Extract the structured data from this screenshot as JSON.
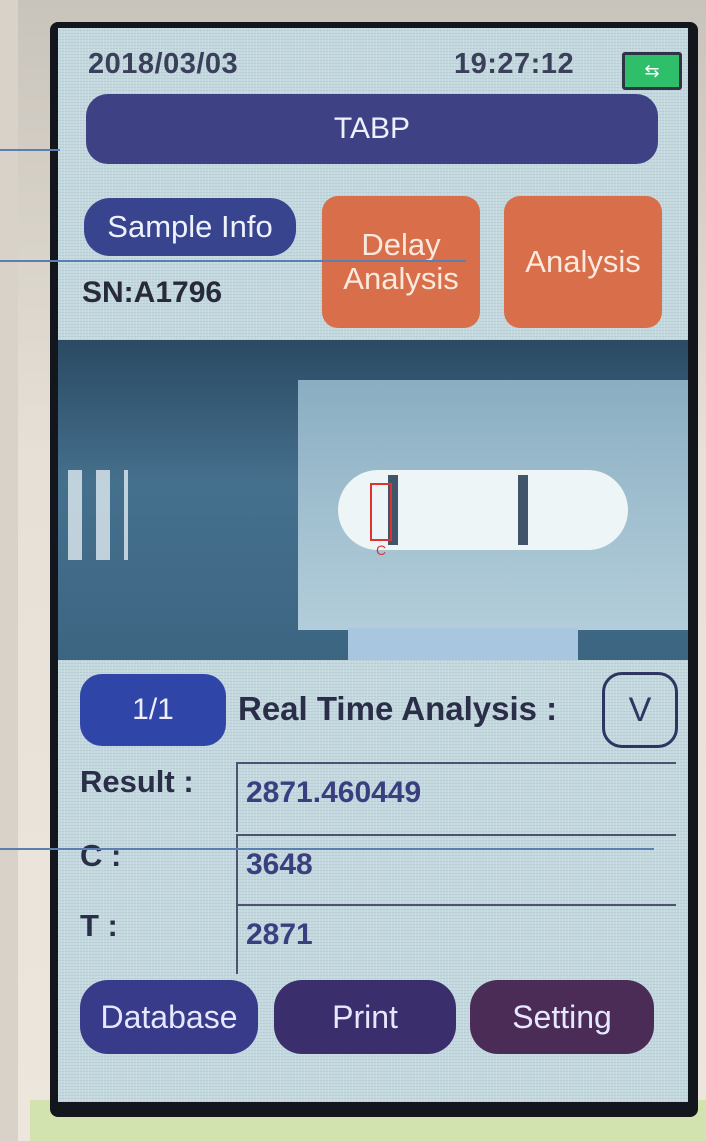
{
  "status_bar": {
    "date": "2018/03/03",
    "time": "19:27:12",
    "battery_icon": "battery-icon"
  },
  "header": {
    "title": "TABP"
  },
  "controls": {
    "sample_info": "Sample Info",
    "serial": "SN:A1796",
    "delay_analysis": "Delay Analysis",
    "analysis": "Analysis"
  },
  "camera": {
    "c_marker": "C"
  },
  "realtime": {
    "page": "1/1",
    "label": "Real Time Analysis :",
    "toggle": "V"
  },
  "results": {
    "result_label": "Result :",
    "result_value": "2871.460449",
    "c_label": "C :",
    "c_value": "3648",
    "t_label": "T :",
    "t_value": "2871"
  },
  "nav": {
    "database": "Database",
    "print": "Print",
    "setting": "Setting"
  },
  "colors": {
    "screen_bg": "#c3d8df",
    "primary_button": "#3e4183",
    "accent_orange": "#d86e4a",
    "battery_green": "#2fbf6a"
  }
}
